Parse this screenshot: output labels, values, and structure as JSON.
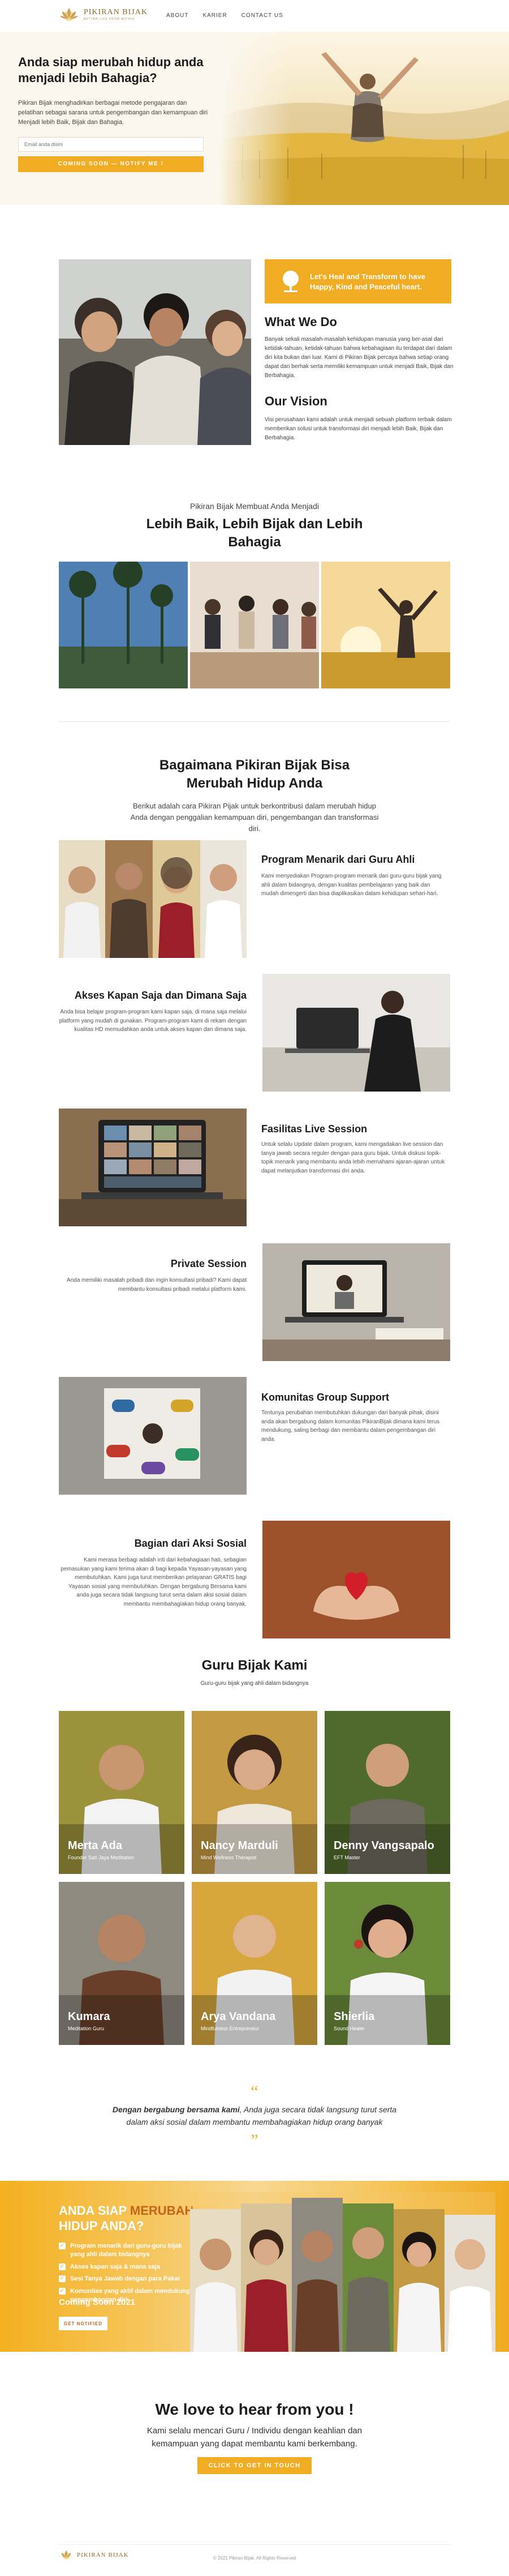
{
  "brand": {
    "name": "PIKIRAN BIJAK",
    "tagline": "BETTER LIFE FROM WITHIN",
    "accent": "#f0ac22",
    "accent_dark": "#c6651a"
  },
  "nav": {
    "items": [
      "ABOUT",
      "KARIER",
      "CONTACT US"
    ]
  },
  "hero": {
    "title": "Anda siap merubah hidup anda menjadi lebih Bahagia?",
    "description": "Pikiran Bijak menghadirkan berbagai metode pengajaran dan pelatihan sebagai sarana untuk pengembangan dan kemampuan diri Menjadi lebih Baik, Bijak dan Bahagia.",
    "email_placeholder": "Email anda disini",
    "button_label": "COMING SOON — NOTIFY ME !"
  },
  "intro": {
    "callout": "Let's Heal and Transform to have Happy, Kind and Peaceful heart.",
    "what_title": "What We Do",
    "what_text": "Banyak sekali masalah-masalah kehidupan manusia yang ber-asal dari ketidak-tahuan, ketidak-tahuan bahwa kebahagiaan itu terdapat dari dalam diri kita bukan dari luar. Kami di Pikiran Bijak percaya bahwa setiap orang dapat dan berhak serta memiliki kemampuan untuk menjadi Baik, Bijak dan Berbahagia.",
    "vision_title": "Our Vision",
    "vision_text": "Visi perusahaan kami adalah untuk menjadi sebuah platform terbaik dalam memberikan solusi untuk transformasi diri menjadi lebih Baik, Bijak dan Berbahagia."
  },
  "why": {
    "kicker": "Pikiran Bijak Membuat Anda Menjadi",
    "title": "Lebih Baik, Lebih Bijak dan Lebih Bahagia"
  },
  "how": {
    "title": "Bagaimana Pikiran Bijak Bisa Merubah Hidup Anda",
    "description": "Berikut adalah cara Pikiran Pijak untuk berkontribusi dalam merubah hidup Anda dengan penggalian kemampuan diri, pengembangan dan transformasi diri."
  },
  "features": [
    {
      "title": "Program Menarik dari Guru Ahli",
      "text": "Kami menyediakan Program-program menarik dari guru-guru bijak yang ahli dalam bidangnya, dengan kualitas pembelajaran yang baik dan mudah dimengerti dan bisa diaplikasikan dalam kehidupan sehari-hari."
    },
    {
      "title": "Akses Kapan Saja dan Dimana Saja",
      "text": "Anda bisa belajar program-program kami kapan saja, di mana saja melalui platform yang mudah di gunakan. Program-program kami di rekam dengan kualitas HD memudahkan anda untuk akses kapan dan dimana saja."
    },
    {
      "title": "Fasilitas Live Session",
      "text": "Untuk selalu Update dalam program, kami mengadakan live session dan tanya jawab secara reguler dengan para guru bijak. Untuk diskusi topik-topik menarik yang membantu anda lebih memahami ajaran-ajaran untuk dapat melanjutkan transformasi diri anda."
    },
    {
      "title": "Private Session",
      "text": "Anda memiliki masalah pribadi dan ingin konsultasi pribadi? Kami dapat membantu konsultasi pribadi melalui platform kami."
    },
    {
      "title": "Komunitas Group Support",
      "text": "Tentunya perubahan membutuhkan dukungan dari banyak pihak, disini anda akan bergabung dalam komunitas PikiranBijak dimana kami terus mendukung, saling berbagi dan membantu dalam pengembangan diri anda."
    },
    {
      "title": "Bagian dari Aksi Sosial",
      "text": "Kami merasa berbagi adalah inti dari kebahagiaan hati, sebagian pemasukan yang kami terima akan di bagi kepada Yayasan-yayasan yang membutuhkan. Kami juga turut memberikan pelayanan GRATIS bagi Yayasan sosial yang membutuhkan. Dengan bergabung Bersama kami anda juga secara tidak langsung turut serta dalam aksi sosial dalam membantu membahagiakan hidup orang banyak."
    }
  ],
  "team": {
    "title": "Guru Bijak Kami",
    "subtitle": "Guru-guru bijak yang ahli dalam bidangnya",
    "members": [
      {
        "name": "Merta Ada",
        "role": "Founder Sati Jaya Meditation"
      },
      {
        "name": "Nancy Marduli",
        "role": "Mind Wellness Therapist"
      },
      {
        "name": "Denny Vangsapalo",
        "role": "EFT Master"
      },
      {
        "name": "Kumara",
        "role": "Meditation Guru"
      },
      {
        "name": "Arya Vandana",
        "role": "Mindfulness Entrepreneur"
      },
      {
        "name": "Shierlia",
        "role": "Sound Healer"
      }
    ]
  },
  "quote": {
    "bold": "Dengan bergabung bersama kami",
    "rest": ", Anda juga secara tidak langsung turut serta dalam aksi sosial dalam membantu membahagiakan hidup orang banyak"
  },
  "banner": {
    "title_prefix": "ANDA SIAP ",
    "title_highlight": "MERUBAH",
    "title_line2": "HIDUP ANDA?",
    "items": [
      "Program menarik dari guru-guru bijak yang ahli dalam bidangnya",
      "Akses kapan saja & mana saja",
      "Sesi Tanya Jawab dengan para Pakar",
      "Komunitas yang aktif dalam mendukung pengembangan diri"
    ],
    "soon": "Coming Soon 2021",
    "button_label": "GET NOTIFIED"
  },
  "contact": {
    "title": "We love to hear from you !",
    "text": "Kami selalu mencari Guru / Individu dengan keahlian dan kemampuan yang dapat membantu kami berkembang.",
    "button_label": "CLICK TO GET IN TOUCH"
  },
  "footer": {
    "copyright": "© 2021 Pikiran Bijak. All Rights Reserved"
  }
}
